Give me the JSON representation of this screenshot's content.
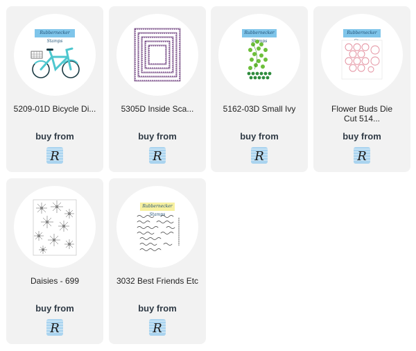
{
  "products": [
    {
      "title": "5209-01D Bicycle Di...",
      "buy_label": "buy from",
      "image_icon": "bicycle-die-image"
    },
    {
      "title": "5305D Inside Sca...",
      "buy_label": "buy from",
      "image_icon": "scalloped-rectangles-image"
    },
    {
      "title": "5162-03D Small Ivy",
      "buy_label": "buy from",
      "image_icon": "ivy-die-image"
    },
    {
      "title": "Flower Buds Die Cut 514...",
      "buy_label": "buy from",
      "image_icon": "flower-buds-die-image"
    },
    {
      "title": "Daisies - 699",
      "buy_label": "buy from",
      "image_icon": "daisies-stamp-image"
    },
    {
      "title": "3032 Best Friends Etc",
      "buy_label": "buy from",
      "image_icon": "best-friends-stamp-image"
    }
  ],
  "brand": {
    "name": "Rubbernecker Stamps",
    "logo_letter": "R",
    "accent": "#7fc5ea"
  },
  "colors": {
    "card_bg": "#f2f2f2",
    "buy_text": "#2f3a45",
    "logo_bg": "#a9d3ef"
  }
}
